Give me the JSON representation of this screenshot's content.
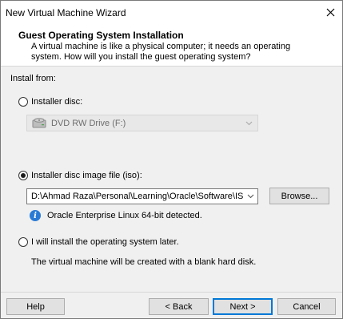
{
  "window": {
    "title": "New Virtual Machine Wizard"
  },
  "header": {
    "title": "Guest Operating System Installation",
    "description": "A virtual machine is like a physical computer; it needs an operating system. How will you install the guest operating system?"
  },
  "install": {
    "label": "Install from:",
    "disc_option": {
      "label": "Installer disc:",
      "selected": false
    },
    "disc_drive": {
      "value": "DVD RW Drive (F:)",
      "enabled": false
    },
    "iso_option": {
      "label": "Installer disc image file (iso):",
      "selected": true
    },
    "iso_path": {
      "value": "D:\\Ahmad Raza\\Personal\\Learning\\Oracle\\Software\\IS"
    },
    "browse_label": "Browse...",
    "detected_info": "Oracle Enterprise Linux 64-bit detected.",
    "later_option": {
      "label": "I will install the operating system later.",
      "selected": false
    },
    "later_note": "The virtual machine will be created with a blank hard disk."
  },
  "footer": {
    "help_label": "Help",
    "back_label": "< Back",
    "next_label": "Next >",
    "cancel_label": "Cancel"
  },
  "colors": {
    "accent": "#0078d7",
    "info_icon": "#2a7ad5",
    "dialog_bg": "#f0f0f0"
  }
}
